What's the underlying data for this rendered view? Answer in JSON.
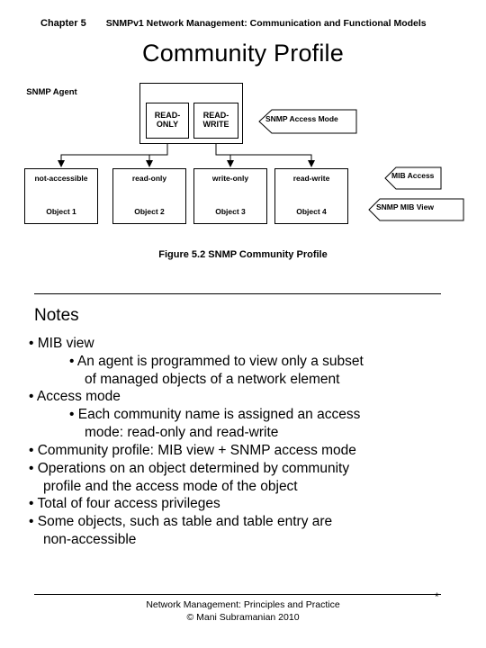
{
  "header": {
    "chapter": "Chapter 5",
    "subject": "SNMPv1 Network Management:  Communication and Functional Models"
  },
  "slide": {
    "title": "Community Profile"
  },
  "figure": {
    "agent_label": "SNMP Agent",
    "read_only_box": "READ-\nONLY",
    "read_only_line1": "READ-",
    "read_only_line2": "ONLY",
    "read_write_line1": "READ-",
    "read_write_line2": "WRITE",
    "callouts": {
      "access_mode": "SNMP Access Mode",
      "mib_access": "MIB Access",
      "mib_view": "SNMP MIB View"
    },
    "columns": [
      {
        "access": "not-accessible",
        "object": "Object 1"
      },
      {
        "access": "read-only",
        "object": "Object 2"
      },
      {
        "access": "write-only",
        "object": "Object 3"
      },
      {
        "access": "read-write",
        "object": "Object 4"
      }
    ],
    "caption": "Figure 5.2  SNMP Community Profile"
  },
  "notes": {
    "heading": "Notes",
    "items": [
      {
        "level": 1,
        "text": "• MIB view"
      },
      {
        "level": 2,
        "text": "• An agent is programmed to view only a subset"
      },
      {
        "level": 2,
        "cont": true,
        "text": "of managed objects of a network element"
      },
      {
        "level": 1,
        "text": "• Access mode"
      },
      {
        "level": 2,
        "text": "• Each community name is assigned an access"
      },
      {
        "level": 2,
        "cont": true,
        "text": "mode:  read-only and read-write"
      },
      {
        "level": 1,
        "text": "• Community profile: MIB view + SNMP access mode"
      },
      {
        "level": 1,
        "text": "• Operations on an object determined by community"
      },
      {
        "level": 1,
        "cont": true,
        "text": "profile and the access mode of the object"
      },
      {
        "level": 1,
        "text": "• Total of four access privileges"
      },
      {
        "level": 1,
        "text": "• Some objects, such as table and table entry are"
      },
      {
        "level": 1,
        "cont": true,
        "text": "non-accessible"
      }
    ]
  },
  "footer": {
    "line1": "Network Management: Principles and Practice",
    "line2": "© Mani Subramanian 2010",
    "asterisk": "*"
  }
}
